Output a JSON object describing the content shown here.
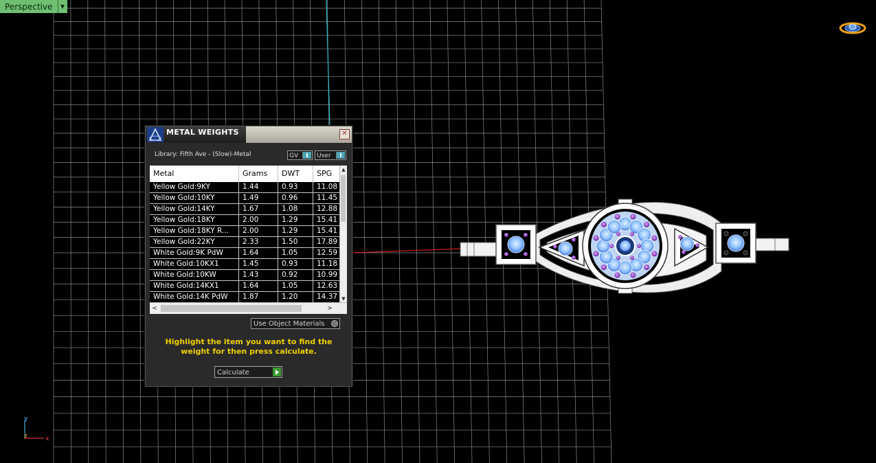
{
  "viewport": {
    "label": "Perspective",
    "icons": {
      "dropdown": "triangle-down-icon",
      "navigation": "ring-navigation-icon",
      "axis": "xyz-axis-icon"
    },
    "axis_labels": {
      "x": "x",
      "y": "y",
      "z": "z"
    },
    "colors": {
      "grid": "#8a8a8a",
      "x_axis": "#c81e1e",
      "y_axis": "#27b8c8",
      "label_bg": "#6fbf73"
    }
  },
  "dialog": {
    "title": "METAL WEIGHTS",
    "logo_icon": "app-logo-icon",
    "close_icon": "close-icon",
    "library_label": "Library: Fifth Ave - (Slow)-Metal",
    "gv_toggle": "GV",
    "user_toggle": "User",
    "table": {
      "headers": [
        "Metal",
        "Grams",
        "DWT",
        "SPG"
      ],
      "rows": [
        [
          "Yellow Gold:9KY",
          "1.44",
          "0.93",
          "11.08"
        ],
        [
          "Yellow Gold:10KY",
          "1.49",
          "0.96",
          "11.45"
        ],
        [
          "Yellow Gold:14KY",
          "1.67",
          "1.08",
          "12.88"
        ],
        [
          "Yellow Gold:18KY",
          "2.00",
          "1.29",
          "15.41"
        ],
        [
          "Yellow Gold:18KY R...",
          "2.00",
          "1.29",
          "15.41"
        ],
        [
          "Yellow Gold:22KY",
          "2.33",
          "1.50",
          "17.89"
        ],
        [
          "White Gold:9K PdW",
          "1.64",
          "1.05",
          "12.59"
        ],
        [
          "White Gold:10KX1",
          "1.45",
          "0.93",
          "11.18"
        ],
        [
          "White Gold:10KW",
          "1.43",
          "0.92",
          "10.99"
        ],
        [
          "White Gold:14KX1",
          "1.64",
          "1.05",
          "12.63"
        ],
        [
          "White Gold:14K PdW",
          "1.87",
          "1.20",
          "14.37"
        ]
      ]
    },
    "use_object_materials": "Use Object Materials",
    "hint": "Highlight the item you want to find the weight for then press calculate.",
    "calculate_label": "Calculate"
  }
}
